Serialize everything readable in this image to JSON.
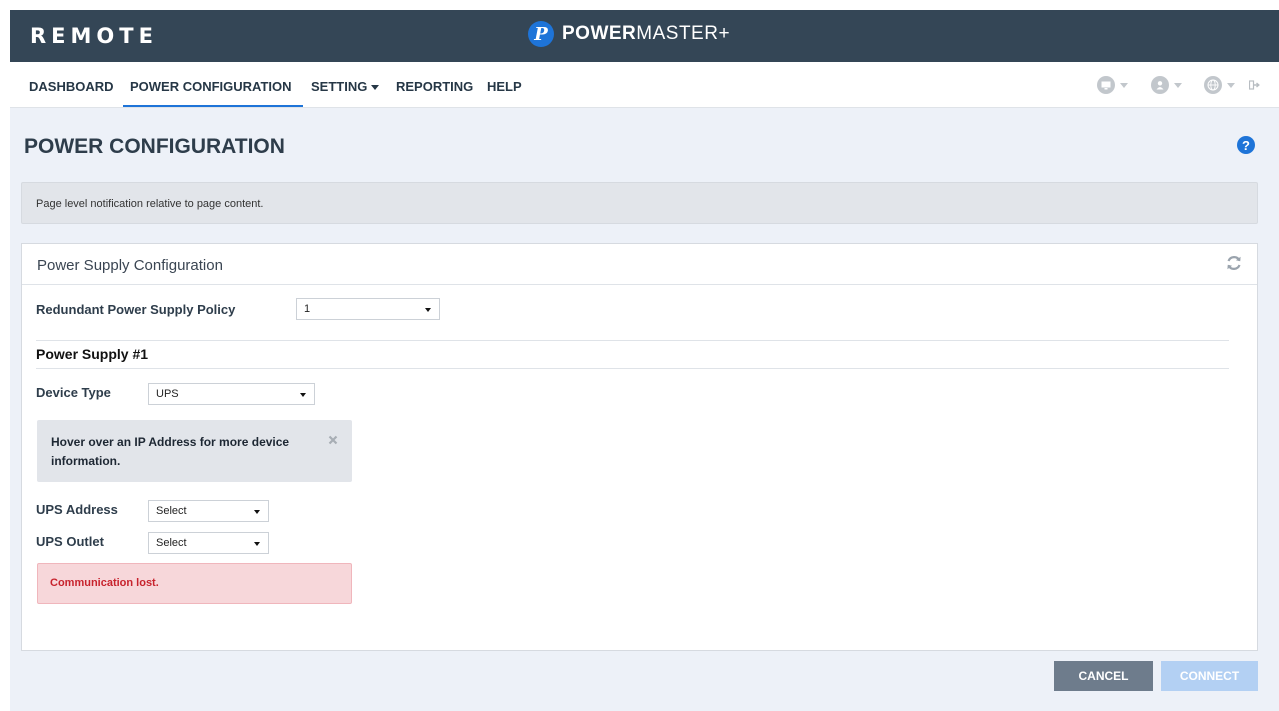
{
  "header": {
    "left_brand": "REMOTE",
    "logo_letter": "P",
    "product_bold": "POWER",
    "product_light": "MASTER+"
  },
  "nav": {
    "items": [
      {
        "label": "DASHBOARD"
      },
      {
        "label": "POWER CONFIGURATION",
        "active": true
      },
      {
        "label": "SETTING",
        "has_dropdown": true
      },
      {
        "label": "REPORTING"
      },
      {
        "label": "HELP"
      }
    ],
    "right_icons": [
      "monitor-icon",
      "user-icon",
      "globe-icon",
      "logout-icon"
    ]
  },
  "page": {
    "title": "POWER CONFIGURATION",
    "help_glyph": "?",
    "notification": "Page level notification relative to page content."
  },
  "panel": {
    "title": "Power Supply Configuration",
    "policy_label": "Redundant Power Supply Policy",
    "policy_value": "1",
    "section_title": "Power Supply #1",
    "device_type_label": "Device Type",
    "device_type_value": "UPS",
    "info_message": "Hover over an IP Address for more device information.",
    "ups_address_label": "UPS Address",
    "ups_address_value": "Select",
    "ups_outlet_label": "UPS Outlet",
    "ups_outlet_value": "Select",
    "error_message": "Communication lost."
  },
  "actions": {
    "cancel_label": "CANCEL",
    "connect_label": "CONNECT"
  },
  "colors": {
    "header_bg": "#344656",
    "accent": "#1e74d8",
    "content_bg": "#edf1f8",
    "error_text": "#c7232d",
    "error_bg": "#f7d7da",
    "cancel_bg": "#6e7c8c",
    "connect_bg_disabled": "#b3d0f3"
  }
}
